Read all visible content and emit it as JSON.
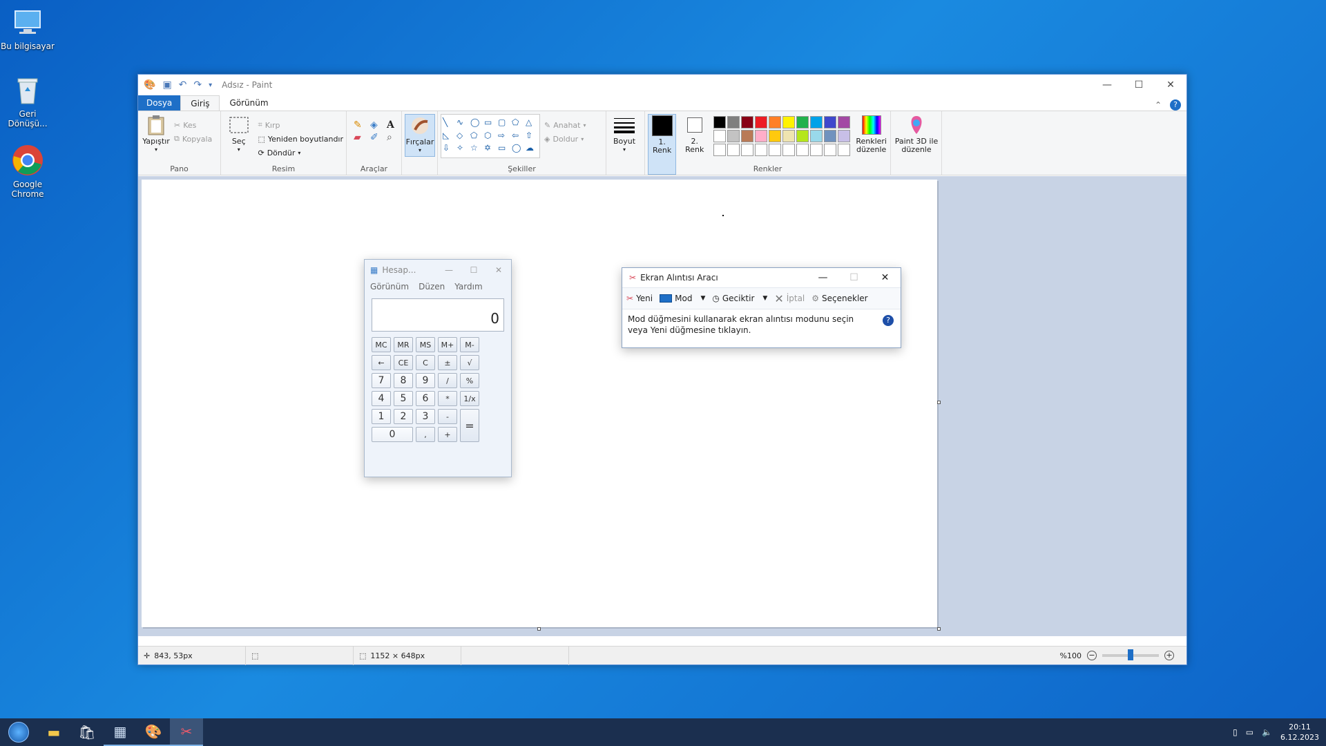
{
  "desktop": {
    "icons": [
      {
        "label": "Bu bilgisayar",
        "icon": "computer-icon"
      },
      {
        "label": "Geri Dönüşü...",
        "icon": "recycle-bin-icon"
      },
      {
        "label": "Google Chrome",
        "icon": "chrome-icon"
      }
    ]
  },
  "paint": {
    "title": "Adsız - Paint",
    "tabs": {
      "file": "Dosya",
      "home": "Giriş",
      "view": "Görünüm"
    },
    "groups": {
      "clipboard": {
        "label": "Pano",
        "paste": "Yapıştır",
        "cut": "Kes",
        "copy": "Kopyala"
      },
      "image": {
        "label": "Resim",
        "select": "Seç",
        "crop": "Kırp",
        "resize": "Yeniden boyutlandır",
        "rotate": "Döndür"
      },
      "tools": {
        "label": "Araçlar"
      },
      "brushes": {
        "label": "Fırçalar"
      },
      "shapes": {
        "label": "Şekiller",
        "outline": "Anahat",
        "fill": "Doldur"
      },
      "size": {
        "label": "Boyut"
      },
      "colors": {
        "label": "Renkler",
        "color1": "1. Renk",
        "color2": "2. Renk",
        "edit": "Renkleri düzenle"
      },
      "paint3d": {
        "label": "Paint 3D ile düzenle"
      }
    },
    "palette_row1": [
      "#000000",
      "#7f7f7f",
      "#880015",
      "#ed1c24",
      "#ff7f27",
      "#fff200",
      "#22b14c",
      "#00a2e8",
      "#3f48cc",
      "#a349a4"
    ],
    "palette_row2": [
      "#ffffff",
      "#c3c3c3",
      "#b97a57",
      "#ffaec9",
      "#ffc90e",
      "#efe4b0",
      "#b5e61d",
      "#99d9ea",
      "#7092be",
      "#c8bfe7"
    ],
    "status": {
      "cursor": "843, 53px",
      "size": "1152 × 648px",
      "zoom": "%100"
    }
  },
  "calculator": {
    "title": "Hesap...",
    "menu": [
      "Görünüm",
      "Düzen",
      "Yardım"
    ],
    "display": "0",
    "keys": [
      [
        "MC",
        "MR",
        "MS",
        "M+",
        "M-"
      ],
      [
        "←",
        "CE",
        "C",
        "±",
        "√"
      ],
      [
        "7",
        "8",
        "9",
        "/",
        "%"
      ],
      [
        "4",
        "5",
        "6",
        "*",
        "1/x"
      ],
      [
        "1",
        "2",
        "3",
        "-",
        "="
      ],
      [
        "0",
        ",",
        "+"
      ]
    ]
  },
  "snip": {
    "title": "Ekran Alıntısı Aracı",
    "new": "Yeni",
    "mode": "Mod",
    "delay": "Geciktir",
    "cancel": "İptal",
    "options": "Seçenekler",
    "message": "Mod düğmesini kullanarak ekran alıntısı modunu seçin veya Yeni düğmesine tıklayın."
  },
  "taskbar": {
    "time": "20:11",
    "date": "6.12.2023"
  }
}
